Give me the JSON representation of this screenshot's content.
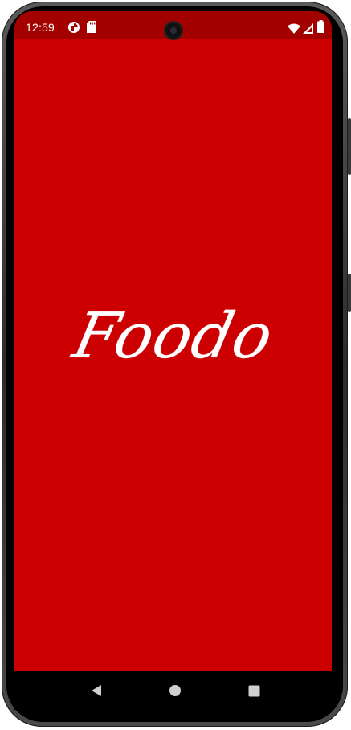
{
  "status_bar": {
    "time": "12:59",
    "left_icons": [
      "photo-app-notification-icon",
      "sd-card-icon"
    ],
    "right_icons": [
      "wifi-icon",
      "cellular-signal-icon",
      "battery-icon"
    ],
    "color": "#a30000"
  },
  "app": {
    "logo_text": "Foodo",
    "background_color": "#cc0000",
    "logo_color": "#ffffff"
  },
  "nav_bar": {
    "buttons": [
      "back-button",
      "home-button",
      "recents-button"
    ]
  }
}
